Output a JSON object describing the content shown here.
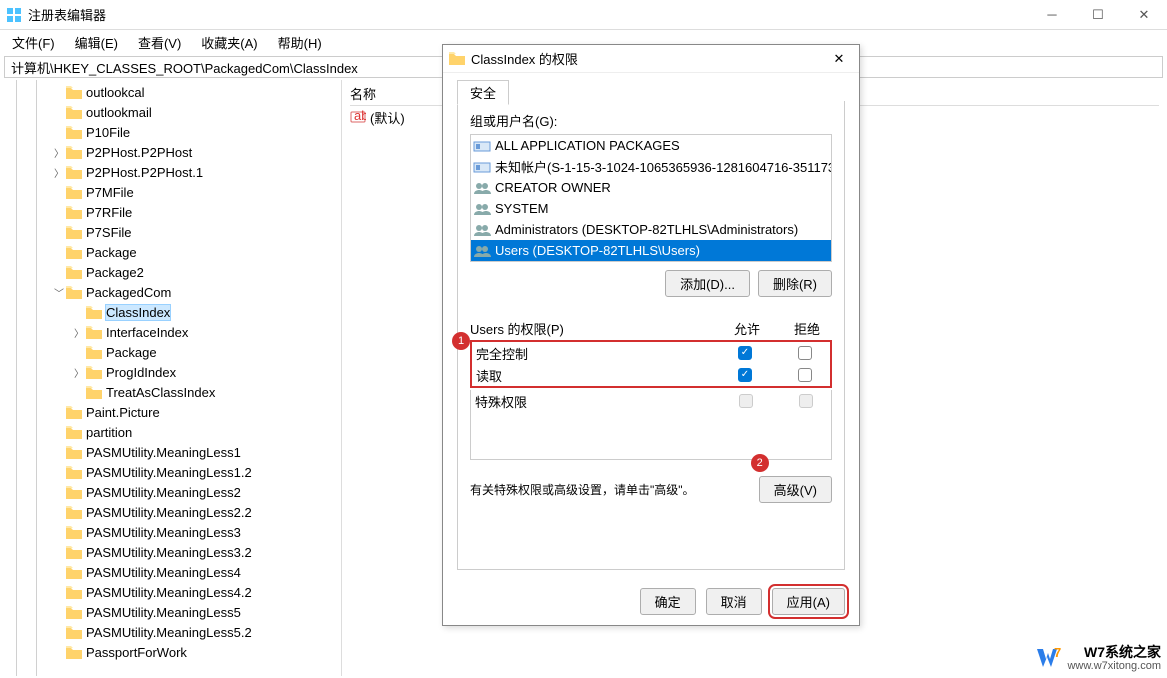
{
  "window": {
    "title": "注册表编辑器"
  },
  "menu": {
    "file": "文件(F)",
    "edit": "编辑(E)",
    "view": "查看(V)",
    "favorites": "收藏夹(A)",
    "help": "帮助(H)"
  },
  "path": "计算机\\HKEY_CLASSES_ROOT\\PackagedCom\\ClassIndex",
  "tree": [
    {
      "level": 2,
      "exp": "",
      "label": "outlookcal"
    },
    {
      "level": 2,
      "exp": "",
      "label": "outlookmail"
    },
    {
      "level": 2,
      "exp": "",
      "label": "P10File"
    },
    {
      "level": 2,
      "exp": ">",
      "label": "P2PHost.P2PHost"
    },
    {
      "level": 2,
      "exp": ">",
      "label": "P2PHost.P2PHost.1"
    },
    {
      "level": 2,
      "exp": "",
      "label": "P7MFile"
    },
    {
      "level": 2,
      "exp": "",
      "label": "P7RFile"
    },
    {
      "level": 2,
      "exp": "",
      "label": "P7SFile"
    },
    {
      "level": 2,
      "exp": "",
      "label": "Package"
    },
    {
      "level": 2,
      "exp": "",
      "label": "Package2"
    },
    {
      "level": 2,
      "exp": "v",
      "label": "PackagedCom"
    },
    {
      "level": 3,
      "exp": "",
      "label": "ClassIndex",
      "selected": true
    },
    {
      "level": 3,
      "exp": ">",
      "label": "InterfaceIndex"
    },
    {
      "level": 3,
      "exp": "",
      "label": "Package"
    },
    {
      "level": 3,
      "exp": ">",
      "label": "ProgIdIndex"
    },
    {
      "level": 3,
      "exp": "",
      "label": "TreatAsClassIndex"
    },
    {
      "level": 2,
      "exp": "",
      "label": "Paint.Picture"
    },
    {
      "level": 2,
      "exp": "",
      "label": "partition"
    },
    {
      "level": 2,
      "exp": "",
      "label": "PASMUtility.MeaningLess1"
    },
    {
      "level": 2,
      "exp": "",
      "label": "PASMUtility.MeaningLess1.2"
    },
    {
      "level": 2,
      "exp": "",
      "label": "PASMUtility.MeaningLess2"
    },
    {
      "level": 2,
      "exp": "",
      "label": "PASMUtility.MeaningLess2.2"
    },
    {
      "level": 2,
      "exp": "",
      "label": "PASMUtility.MeaningLess3"
    },
    {
      "level": 2,
      "exp": "",
      "label": "PASMUtility.MeaningLess3.2"
    },
    {
      "level": 2,
      "exp": "",
      "label": "PASMUtility.MeaningLess4"
    },
    {
      "level": 2,
      "exp": "",
      "label": "PASMUtility.MeaningLess4.2"
    },
    {
      "level": 2,
      "exp": "",
      "label": "PASMUtility.MeaningLess5"
    },
    {
      "level": 2,
      "exp": "",
      "label": "PASMUtility.MeaningLess5.2"
    },
    {
      "level": 2,
      "exp": "",
      "label": "PassportForWork"
    }
  ],
  "values_header": "名称",
  "values": [
    {
      "name": "(默认)"
    }
  ],
  "dialog": {
    "title": "ClassIndex 的权限",
    "tab": "安全",
    "group_label": "组或用户名(G):",
    "users": [
      {
        "name": "ALL APPLICATION PACKAGES",
        "icon": "group"
      },
      {
        "name": "未知帐户(S-1-15-3-1024-1065365936-1281604716-351173...",
        "icon": "group"
      },
      {
        "name": "CREATOR OWNER",
        "icon": "people"
      },
      {
        "name": "SYSTEM",
        "icon": "people"
      },
      {
        "name": "Administrators (DESKTOP-82TLHLS\\Administrators)",
        "icon": "people"
      },
      {
        "name": "Users (DESKTOP-82TLHLS\\Users)",
        "icon": "people",
        "selected": true
      }
    ],
    "add_btn": "添加(D)...",
    "remove_btn": "删除(R)",
    "perm_label": "Users 的权限(P)",
    "allow_hdr": "允许",
    "deny_hdr": "拒绝",
    "perms_boxed": [
      {
        "name": "完全控制",
        "allow": true,
        "deny": false
      },
      {
        "name": "读取",
        "allow": true,
        "deny": false
      }
    ],
    "perms_extra": [
      {
        "name": "特殊权限",
        "allow_disabled": true,
        "deny_disabled": true
      }
    ],
    "advanced_text": "有关特殊权限或高级设置，请单击\"高级\"。",
    "advanced_btn": "高级(V)",
    "ok_btn": "确定",
    "cancel_btn": "取消",
    "apply_btn": "应用(A)",
    "annot1": "1",
    "annot2": "2"
  },
  "watermark": {
    "main": "W7系统之家",
    "sub": "www.w7xitong.com"
  }
}
